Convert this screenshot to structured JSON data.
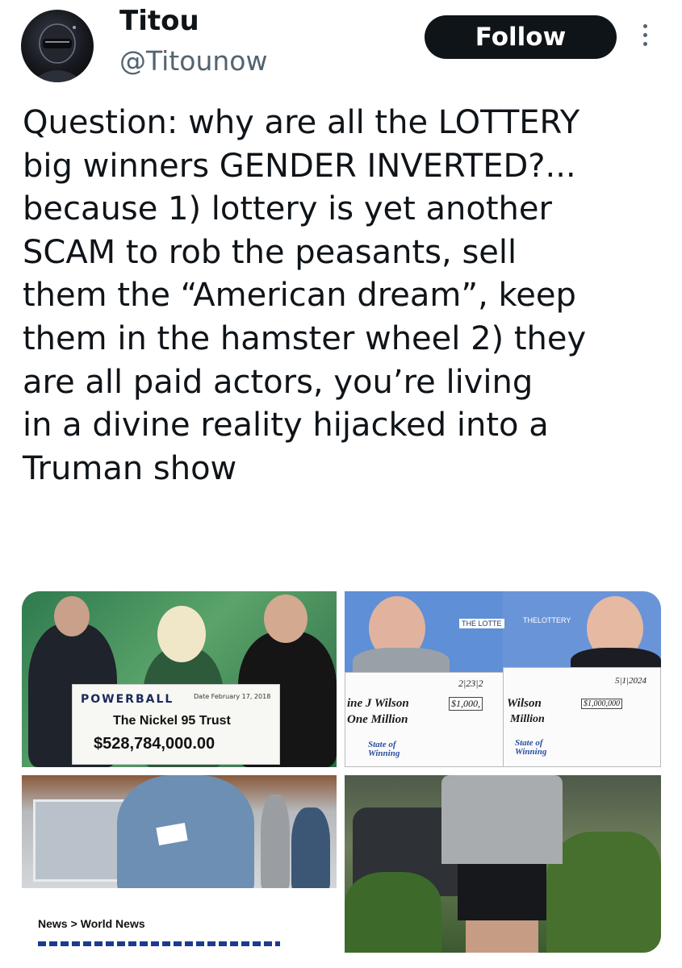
{
  "author": {
    "display_name": "Titou",
    "handle": "@Titounow",
    "avatar_icon": "avatar-icon"
  },
  "actions": {
    "follow_label": "Follow",
    "more_icon": "more-options-icon"
  },
  "tweet": {
    "lines": [
      "Question: why are all the LOTTERY",
      "big winners GENDER INVERTED?...",
      "because 1) lottery is yet another",
      "SCAM to rob the peasants, sell",
      "them the “American dream”, keep",
      "them in the hamster wheel 2) they",
      "are all paid actors, you’re living",
      "in a divine reality hijacked into a",
      "Truman show"
    ]
  },
  "media": {
    "image1": {
      "logo": "POWERBALL",
      "date": "Date February 17, 2018",
      "payee": "The Nickel 95 Trust",
      "amount": "$528,784,000.00"
    },
    "image2": {
      "sign_left": "THE LOTTE",
      "sign_right": "THELOTTERY",
      "date_left": "2|23|2",
      "date_right": "5|1|2024",
      "name_left": "ine J Wilson",
      "amount_left": "$1,000,",
      "words_left": "One Million",
      "name_right": "Wilson",
      "amount_right": "$1,000,000",
      "words_right": "Million",
      "state_of_winning": "State of Winning"
    },
    "image4": {},
    "image3": {
      "breadcrumb_first": "News",
      "breadcrumb_separator": ">",
      "breadcrumb_second": "World News"
    }
  },
  "colors": {
    "text_primary": "#0f1419",
    "text_secondary": "#536471",
    "button_bg": "#0f1419",
    "button_text": "#ffffff"
  }
}
